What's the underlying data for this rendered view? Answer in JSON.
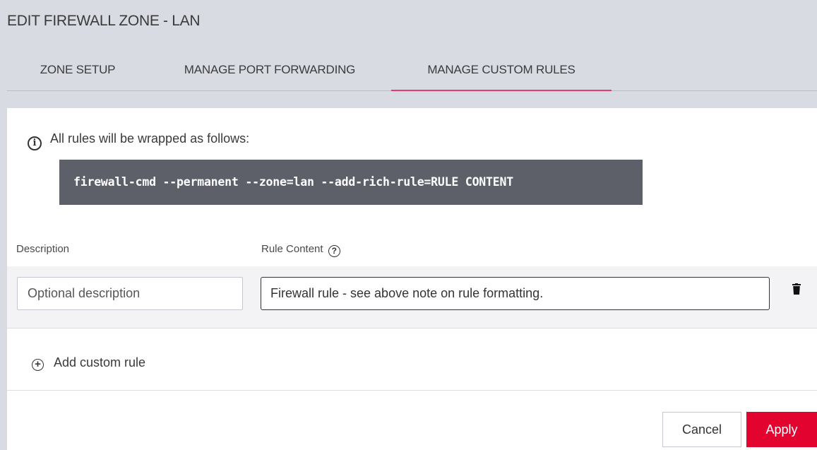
{
  "header": {
    "title": "EDIT FIREWALL ZONE - LAN",
    "tabs": [
      {
        "label": "ZONE SETUP",
        "active": false
      },
      {
        "label": "MANAGE PORT FORWARDING",
        "active": false
      },
      {
        "label": "MANAGE CUSTOM RULES",
        "active": true
      }
    ],
    "active_tab_color": "#e23c73"
  },
  "info": {
    "icon": "info-icon",
    "text": "All rules will be wrapped as follows:",
    "code": "firewall-cmd --permanent --zone=lan --add-rich-rule=RULE CONTENT"
  },
  "columns": {
    "description": "Description",
    "rule_content": "Rule Content",
    "rule_content_help_icon": "question-circle-icon"
  },
  "rules": [
    {
      "description_placeholder": "Optional description",
      "description_value": "",
      "rule_value": "Firewall rule - see above note on rule formatting.",
      "delete_icon": "trash-icon"
    }
  ],
  "add_rule": {
    "label": "Add custom rule",
    "icon": "plus-circle-icon"
  },
  "actions": {
    "cancel_label": "Cancel",
    "apply_label": "Apply",
    "apply_color": "#e2032f"
  }
}
